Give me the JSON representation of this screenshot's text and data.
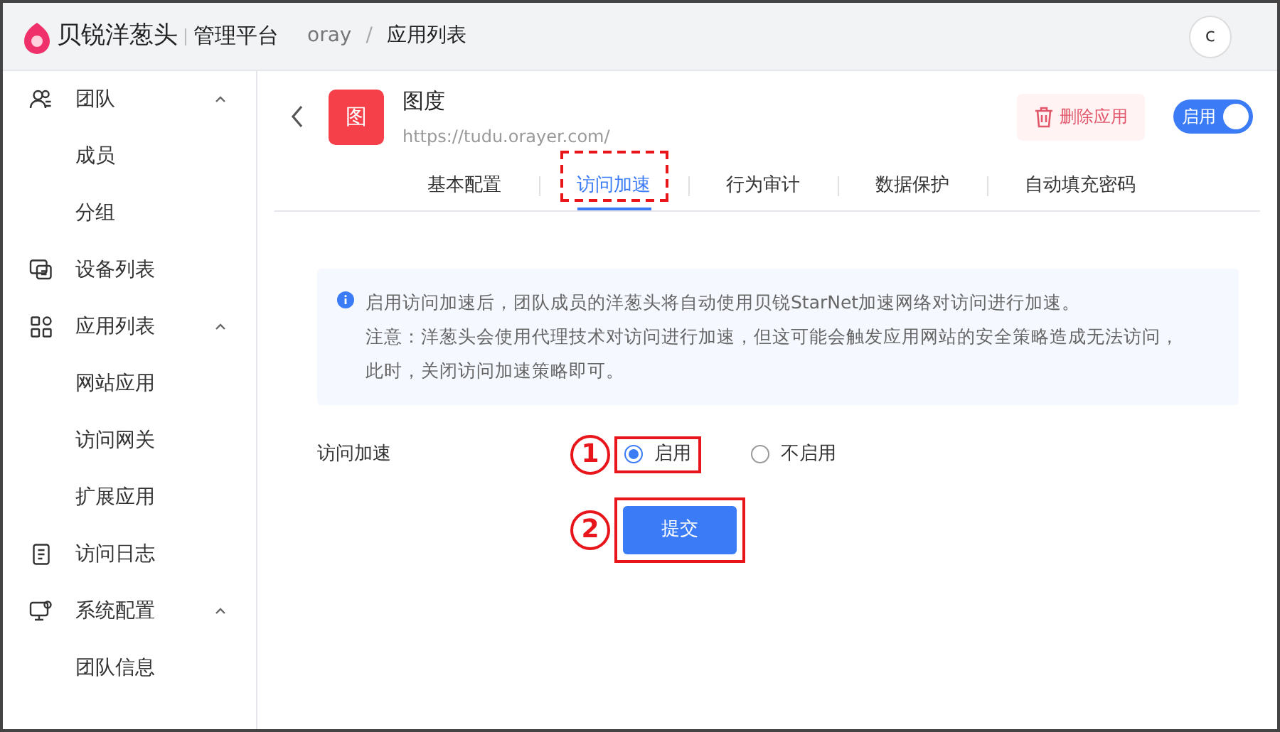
{
  "header": {
    "brand": "贝锐洋葱头",
    "product": "管理平台",
    "breadcrumb": [
      "oray",
      "应用列表"
    ],
    "breadcrumb_separator": "/",
    "avatar": "c"
  },
  "sidebar": {
    "items": [
      {
        "label": "团队",
        "expanded": true,
        "children": [
          {
            "label": "成员"
          },
          {
            "label": "分组"
          }
        ]
      },
      {
        "label": "设备列表"
      },
      {
        "label": "应用列表",
        "expanded": true,
        "children": [
          {
            "label": "网站应用"
          },
          {
            "label": "访问网关"
          },
          {
            "label": "扩展应用"
          }
        ]
      },
      {
        "label": "访问日志"
      },
      {
        "label": "系统配置",
        "expanded": true,
        "children": [
          {
            "label": "团队信息"
          }
        ]
      }
    ]
  },
  "app": {
    "icon_text": "图",
    "name": "图度",
    "url": "https://tudu.orayer.com/",
    "delete_button": "删除应用",
    "toggle": {
      "label": "启用",
      "on": true
    }
  },
  "tabs": [
    {
      "label": "基本配置",
      "selected": false
    },
    {
      "label": "访问加速",
      "selected": true
    },
    {
      "label": "行为审计",
      "selected": false
    },
    {
      "label": "数据保护",
      "selected": false
    },
    {
      "label": "自动填充密码",
      "selected": false
    }
  ],
  "notice": [
    "启用访问加速后，团队成员的洋葱头将自动使用贝锐StarNet加速网络对访问进行加速。",
    "注意：洋葱头会使用代理技术对访问进行加速，但这可能会触发应用网站的安全策略造成无法访问，此时，关闭访问加速策略即可。"
  ],
  "form": {
    "label": "访问加速",
    "options": [
      {
        "label": "启用",
        "selected": true
      },
      {
        "label": "不启用",
        "selected": false
      }
    ],
    "submit": "提交"
  },
  "annotations": [
    "1",
    "2"
  ]
}
